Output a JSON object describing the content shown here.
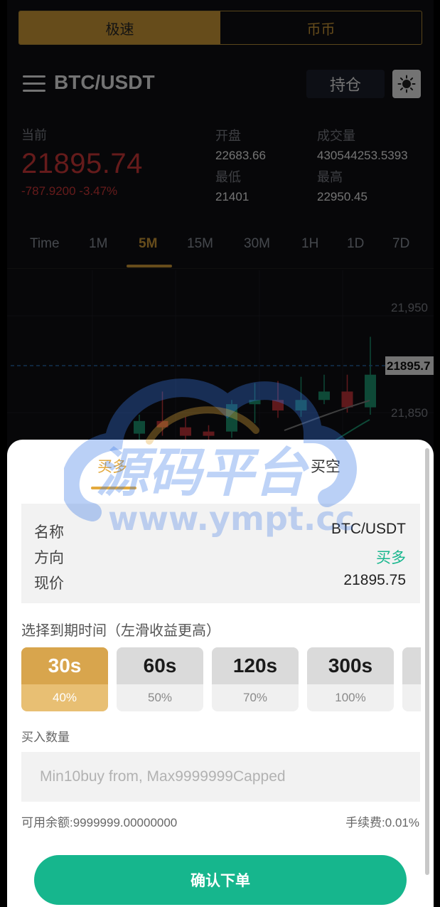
{
  "mode_tabs": {
    "fast": "极速",
    "spot": "币币",
    "active": "fast"
  },
  "header": {
    "pair": "BTC/USDT",
    "hold_button": "持仓"
  },
  "stats": {
    "current_label": "当前",
    "current_price": "21895.74",
    "change": "-787.9200 -3.47%",
    "open_label": "开盘",
    "open_value": "22683.66",
    "low_label": "最低",
    "low_value": "21401",
    "volume_label": "成交量",
    "volume_value": "430544253.5393",
    "high_label": "最高",
    "high_value": "22950.45"
  },
  "periods": [
    "Time",
    "1M",
    "5M",
    "15M",
    "30M",
    "1H",
    "1D",
    "7D"
  ],
  "active_period": "5M",
  "chart_data": {
    "type": "candlestick",
    "price_labels": [
      "21,950",
      "21,850"
    ],
    "current_price_label": "21895.7",
    "candles": [
      {
        "open": 21830,
        "close": 21842,
        "high": 21848,
        "low": 21820,
        "color": "#1fa37a"
      },
      {
        "open": 21842,
        "close": 21836,
        "high": 21870,
        "low": 21828,
        "color": "#d2393f"
      },
      {
        "open": 21836,
        "close": 21828,
        "high": 21846,
        "low": 21815,
        "color": "#d2393f"
      },
      {
        "open": 21828,
        "close": 21832,
        "high": 21838,
        "low": 21810,
        "color": "#d2393f"
      },
      {
        "open": 21832,
        "close": 21858,
        "high": 21862,
        "low": 21826,
        "color": "#1fa37a"
      },
      {
        "open": 21858,
        "close": 21862,
        "high": 21878,
        "low": 21840,
        "color": "#1fa37a"
      },
      {
        "open": 21862,
        "close": 21852,
        "high": 21880,
        "low": 21845,
        "color": "#d2393f"
      },
      {
        "open": 21852,
        "close": 21862,
        "high": 21884,
        "low": 21846,
        "color": "#1fa37a"
      },
      {
        "open": 21862,
        "close": 21870,
        "high": 21886,
        "low": 21858,
        "color": "#1fa37a"
      },
      {
        "open": 21870,
        "close": 21855,
        "high": 21886,
        "low": 21850,
        "color": "#d2393f"
      },
      {
        "open": 21855,
        "close": 21886,
        "high": 21922,
        "low": 21848,
        "color": "#1fa37a"
      }
    ],
    "colors": {
      "up": "#1fa37a",
      "down": "#d2393f",
      "price_line": "#2b6fb3"
    }
  },
  "watermark": {
    "text_cn": "源码平台",
    "text_url": "www.ympt.cc"
  },
  "order_panel": {
    "tab_long": "买多",
    "tab_short": "买空",
    "active_tab": "long",
    "name_label": "名称",
    "name_value": "BTC/USDT",
    "direction_label": "方向",
    "direction_value": "买多",
    "price_label": "现价",
    "price_value": "21895.75",
    "expiry_title": "选择到期时间（左滑收益更高）",
    "expiry_options": [
      {
        "time": "30s",
        "rate": "40%"
      },
      {
        "time": "60s",
        "rate": "50%"
      },
      {
        "time": "120s",
        "rate": "70%"
      },
      {
        "time": "300s",
        "rate": "100%"
      },
      {
        "time": "",
        "rate": ""
      }
    ],
    "active_expiry": 0,
    "quantity_label": "买入数量",
    "quantity_placeholder": "Min10buy from, Max9999999Capped",
    "balance": "可用余额:9999999.00000000",
    "fee": "手续费:0.01%",
    "confirm": "确认下单"
  },
  "colors": {
    "accent": "#e3a93d",
    "green": "#16b68d",
    "red": "#e03c3c"
  }
}
